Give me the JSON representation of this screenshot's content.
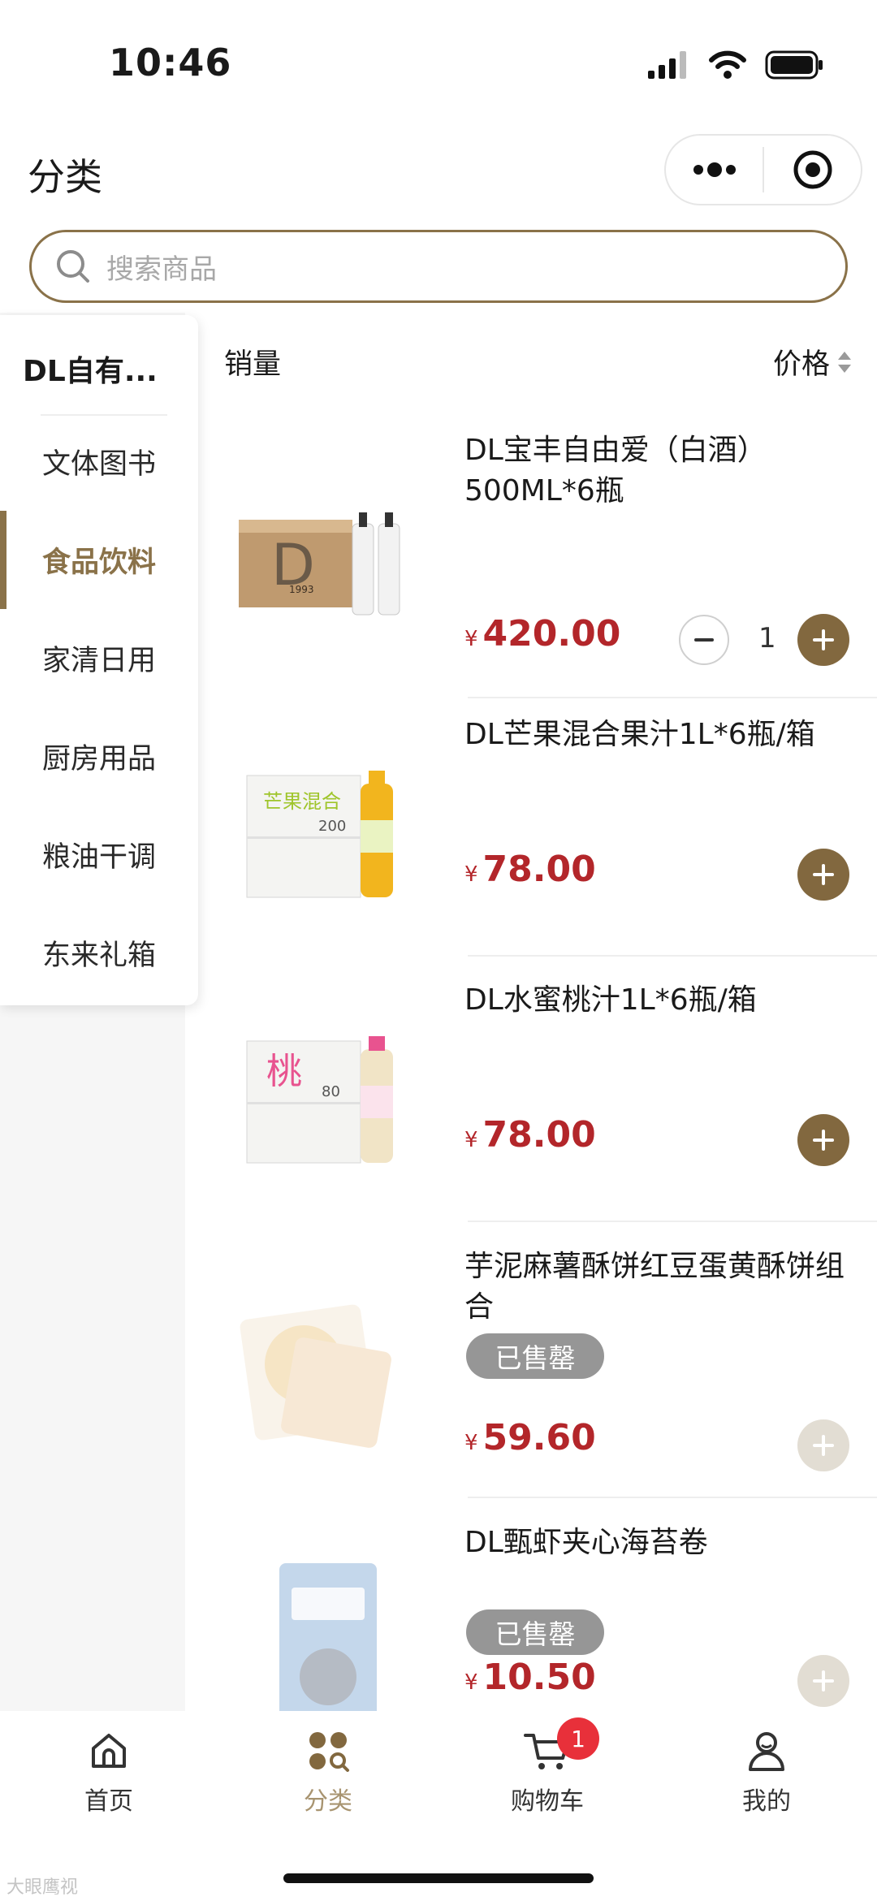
{
  "status_bar": {
    "time": "10:46"
  },
  "nav": {
    "title": "分类"
  },
  "search": {
    "placeholder": "搜索商品"
  },
  "sidebar": {
    "header": "DL自有...",
    "items": [
      {
        "label": "文体图书",
        "active": false
      },
      {
        "label": "食品饮料",
        "active": true
      },
      {
        "label": "家清日用",
        "active": false
      },
      {
        "label": "厨房用品",
        "active": false
      },
      {
        "label": "粮油干调",
        "active": false
      },
      {
        "label": "东来礼箱",
        "active": false
      }
    ]
  },
  "sort": {
    "sales_label": "销量",
    "price_label": "价格"
  },
  "currency_symbol": "¥",
  "products": [
    {
      "name": "DL宝丰自由爱（白酒）500ML*6瓶",
      "price": "420.00",
      "quantity": "1",
      "sold_out": false
    },
    {
      "name": "DL芒果混合果汁1L*6瓶/箱",
      "price": "78.00",
      "sold_out": false
    },
    {
      "name": "DL水蜜桃汁1L*6瓶/箱",
      "price": "78.00",
      "sold_out": false
    },
    {
      "name": "芋泥麻薯酥饼红豆蛋黄酥饼组合",
      "price": "59.60",
      "sold_out": true,
      "sold_out_label": "已售罄"
    },
    {
      "name": "DL甄虾夹心海苔卷",
      "price": "10.50",
      "sold_out": true,
      "sold_out_label": "已售罄"
    }
  ],
  "product_images": {
    "baijiu_box_text": "D",
    "baijiu_year": "1993",
    "mango_box_text": "芒果混合",
    "mango_count": "200",
    "peach_box_text": "桃",
    "peach_count": "80"
  },
  "tabbar": {
    "home": "首页",
    "category": "分类",
    "cart": "购物车",
    "cart_badge": "1",
    "mine": "我的"
  },
  "watermark": "大眼鹰视",
  "colors": {
    "accent": "#8a7249",
    "price": "#b3262a",
    "badge": "#e8303a",
    "tab_active": "#a89470"
  }
}
